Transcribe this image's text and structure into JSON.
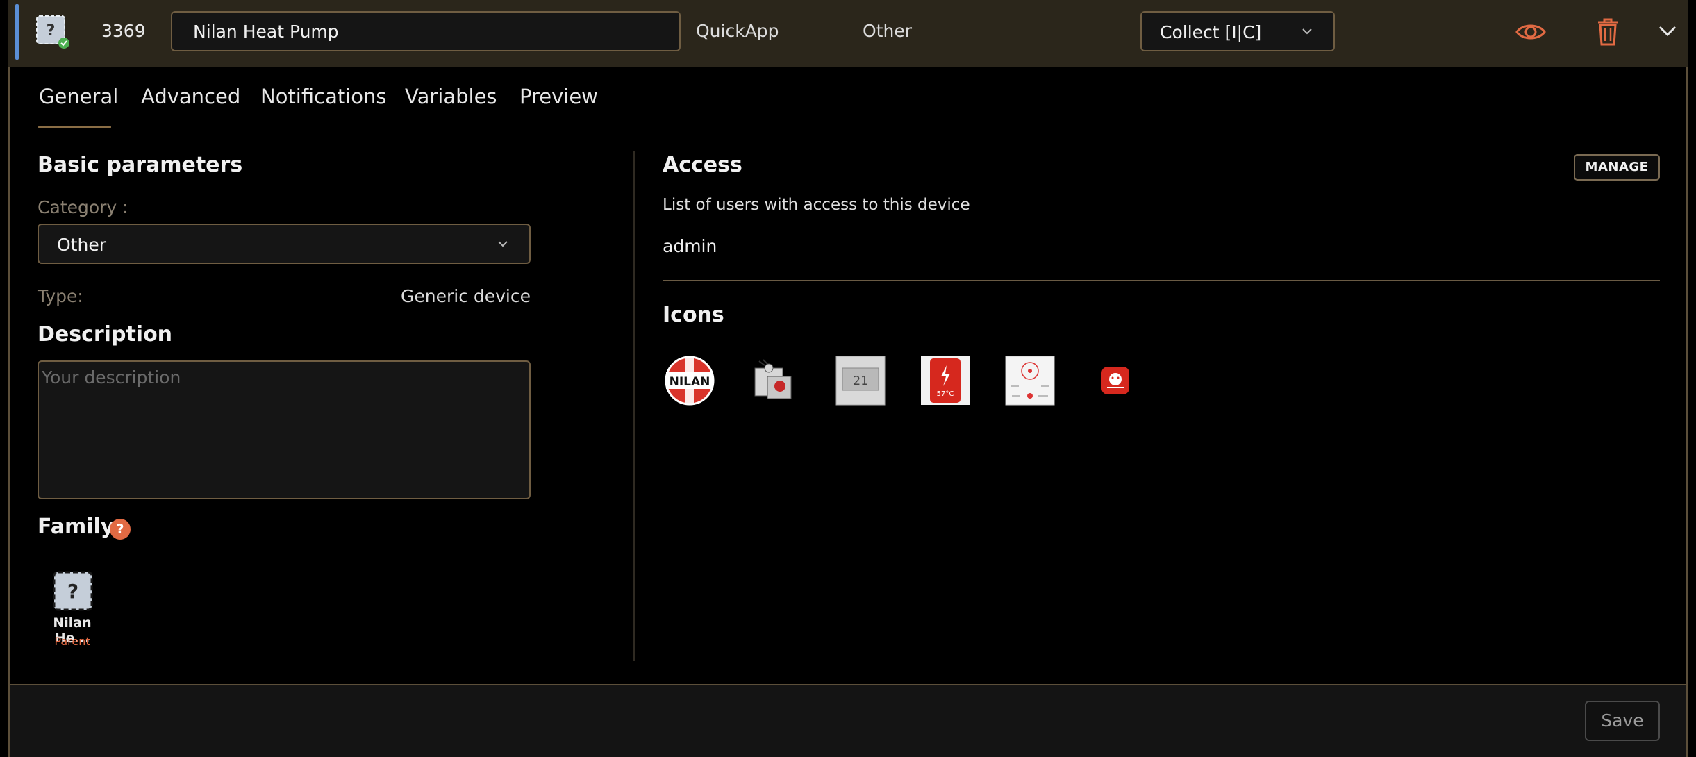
{
  "header": {
    "device_id": "3369",
    "device_name": "Nilan Heat Pump",
    "type_label": "QuickApp",
    "category_label": "Other",
    "collect_label": "Collect [I|C]"
  },
  "tabs": [
    {
      "label": "General"
    },
    {
      "label": "Advanced"
    },
    {
      "label": "Notifications"
    },
    {
      "label": "Variables"
    },
    {
      "label": "Preview"
    }
  ],
  "basic": {
    "title": "Basic parameters",
    "category_label": "Category :",
    "category_value": "Other",
    "type_label": "Type:",
    "type_value": "Generic device",
    "description_title": "Description",
    "description_placeholder": "Your description",
    "family_title": "Family",
    "family_help": "?",
    "family_item_name": "Nilan He...",
    "family_item_role": "Parent"
  },
  "access": {
    "title": "Access",
    "manage_label": "MANAGE",
    "subtitle": "List of users with access to this device",
    "user": "admin"
  },
  "icons": {
    "title": "Icons",
    "items": [
      {
        "name": "nilan-logo-icon",
        "text": "NILAN"
      },
      {
        "name": "puzzle-icon",
        "text": ""
      },
      {
        "name": "thermostat-display-icon",
        "text": "21"
      },
      {
        "name": "heater-57c-icon",
        "text": "57°C"
      },
      {
        "name": "dashboard-icon",
        "text": ""
      },
      {
        "name": "red-app-icon",
        "text": ""
      }
    ]
  },
  "footer": {
    "save_label": "Save"
  },
  "colors": {
    "accent": "#e26a43",
    "border": "#6f5d42",
    "topbar": "#2b261b"
  }
}
